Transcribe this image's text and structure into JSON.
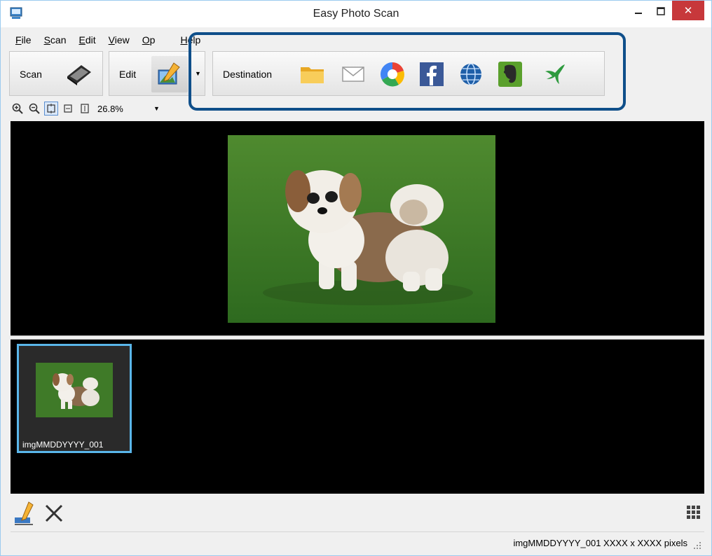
{
  "window": {
    "title": "Easy Photo Scan",
    "close_label": "✕"
  },
  "menu": {
    "items": [
      {
        "label": "File",
        "u": "F",
        "rest": "ile"
      },
      {
        "label": "Scan",
        "u": "S",
        "rest": "can"
      },
      {
        "label": "Edit",
        "u": "E",
        "rest": "dit"
      },
      {
        "label": "View",
        "u": "V",
        "rest": "iew"
      },
      {
        "label": "Option",
        "u": "O",
        "rest": "p"
      },
      {
        "label": "Help",
        "u": "H",
        "rest": "elp"
      }
    ]
  },
  "toolbar": {
    "scan_label": "Scan",
    "edit_label": "Edit",
    "destination_label": "Destination",
    "destinations": [
      "folder-icon",
      "email-icon",
      "photo-service-icon",
      "facebook-icon",
      "web-icon",
      "evernote-icon",
      "bird-icon"
    ]
  },
  "zoom": {
    "value": "26.8%"
  },
  "thumbnail": {
    "label": "imgMMDDYYYY_001"
  },
  "status": {
    "text": "imgMMDDYYYY_001 XXXX x XXXX pixels"
  },
  "colors": {
    "highlight_border": "#0f4f8a",
    "thumbnail_border": "#5ab6ea",
    "close_button": "#c7383b"
  }
}
